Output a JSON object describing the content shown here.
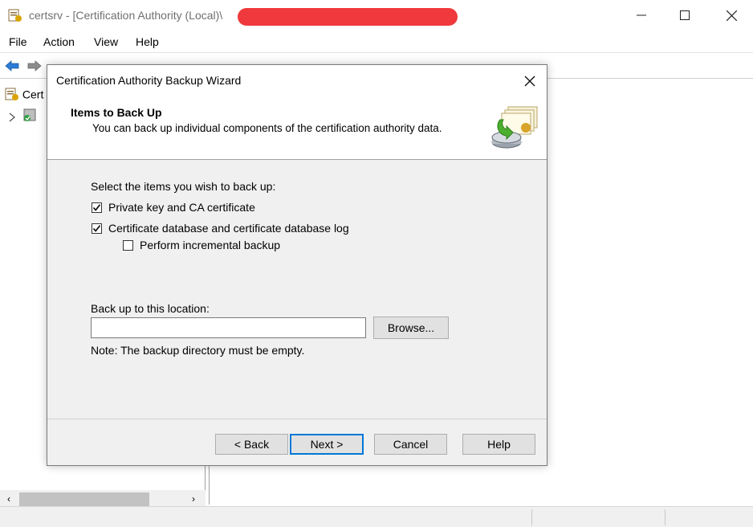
{
  "window": {
    "title": "certsrv - [Certification Authority (Local)\\",
    "minimize_icon": "minimize-icon",
    "maximize_icon": "maximize-icon",
    "close_icon": "close-icon"
  },
  "menu": {
    "items": [
      "File",
      "Action",
      "View",
      "Help"
    ]
  },
  "toolbar": {
    "icons": [
      "back-arrow-icon",
      "forward-arrow-icon",
      "up-folder-icon",
      "show-hide-tree-icon",
      "refresh-icon",
      "export-list-icon",
      "help-icon",
      "start-service-icon",
      "stop-service-icon"
    ]
  },
  "tree": {
    "root_label": "Cert",
    "child_label": ""
  },
  "dialog": {
    "title": "Certification Authority Backup Wizard",
    "header_title": "Items to Back Up",
    "header_subtitle": "You can back up individual components of the certification authority data.",
    "instruction": "Select the items you wish to back up:",
    "options": [
      {
        "label": "Private key and CA certificate",
        "checked": true
      },
      {
        "label": "Certificate database and certificate database log",
        "checked": true
      },
      {
        "label": "Perform incremental backup",
        "checked": false
      }
    ],
    "location_label": "Back up to this location:",
    "location_value": "",
    "browse_label": "Browse...",
    "note": "Note: The backup directory must be empty.",
    "buttons": {
      "back": "< Back",
      "next": "Next >",
      "cancel": "Cancel",
      "help": "Help"
    }
  },
  "colors": {
    "redaction": "#f0393c",
    "accent": "#0078d7",
    "dialog_bg": "#f0f0f0"
  }
}
